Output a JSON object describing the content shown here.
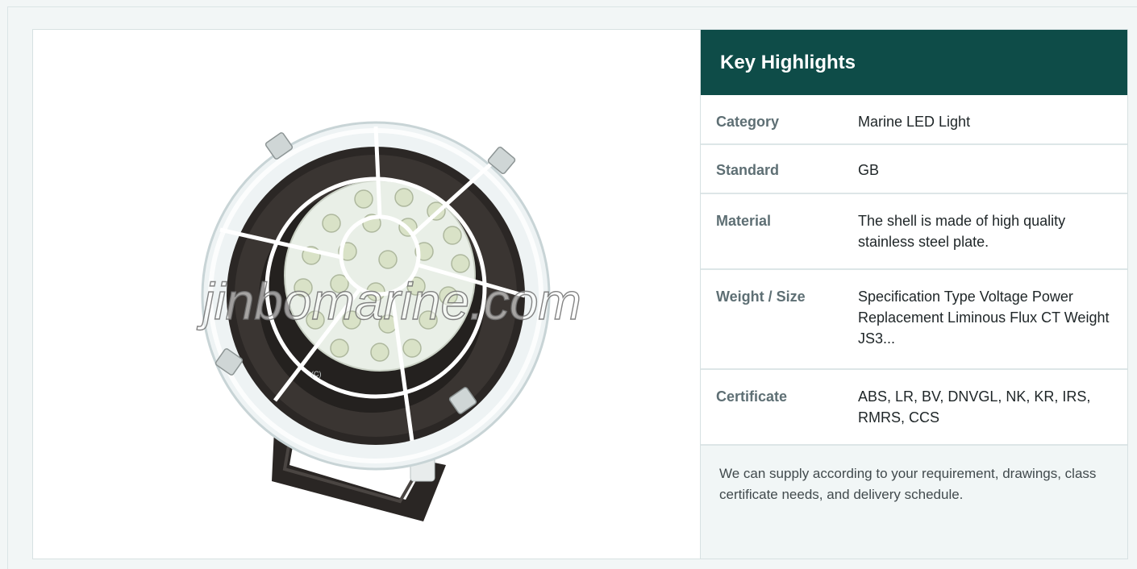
{
  "image": {
    "watermark": "jinbomarine.com",
    "icon": "marine-led-floodlight"
  },
  "highlights": {
    "title": "Key Highlights",
    "rows": [
      {
        "label": "Category",
        "value": "Marine LED Light"
      },
      {
        "label": "Standard",
        "value": "GB"
      },
      {
        "label": "Material",
        "value": "The shell is made of high quality stainless steel plate."
      },
      {
        "label": "Weight / Size",
        "value": "Specification Type Voltage Power Replacement Liminous Flux CT Weight JS3..."
      },
      {
        "label": "Certificate",
        "value": "ABS, LR, BV, DNVGL, NK, KR, IRS, RMRS, CCS"
      }
    ],
    "note": "We can supply according to your requirement, drawings, class certificate needs, and delivery schedule."
  },
  "colors": {
    "header_bg": "#0e4c48",
    "page_bg": "#f2f6f6",
    "label": "#5e6f74",
    "value": "#1e2527",
    "note_bg": "#f1f6f6"
  }
}
